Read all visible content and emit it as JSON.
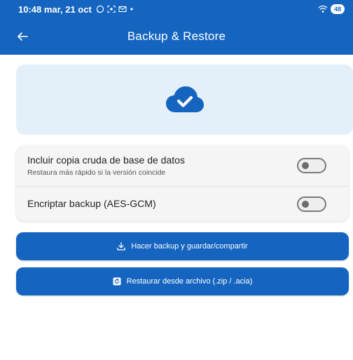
{
  "status_bar": {
    "time_date": "10:48  mar, 21 oct",
    "notification_icons": [
      "whatsapp-icon",
      "screen-record-icon",
      "mail-icon",
      "dot-icon"
    ],
    "battery": "48",
    "wifi_icon": "wifi-icon"
  },
  "app_bar": {
    "back_icon": "arrow-back-icon",
    "title": "Backup & Restore"
  },
  "hero": {
    "icon": "cloud-check-icon"
  },
  "options": [
    {
      "title": "Incluir copia cruda de base de datos",
      "subtitle": "Restaura más rápido si la versión coincide",
      "enabled": false
    },
    {
      "title": "Encriptar backup (AES-GCM)",
      "enabled": false
    }
  ],
  "actions": {
    "backup_label": "Hacer backup y guardar/compartir",
    "restore_label": "Restaurar desde archivo (.zip / .acia)"
  },
  "colors": {
    "primary": "#1565c0",
    "hero_bg": "#e3f0fa",
    "card_bg": "#f5f5f5"
  }
}
